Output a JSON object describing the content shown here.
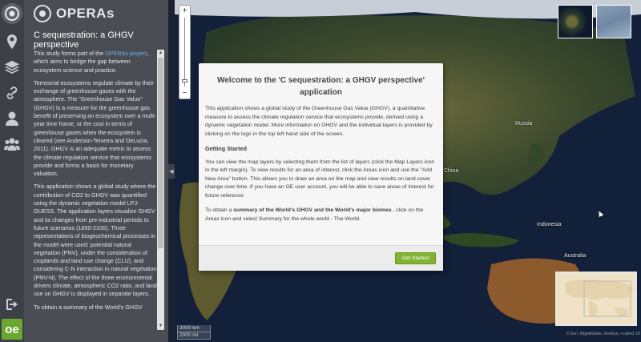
{
  "rail": {
    "items": [
      {
        "name": "logo",
        "icon": "globe-logo-icon"
      },
      {
        "name": "areas",
        "icon": "map-marker-icon"
      },
      {
        "name": "layers",
        "icon": "layers-icon"
      },
      {
        "name": "links",
        "icon": "link-icon"
      },
      {
        "name": "user",
        "icon": "user-icon"
      },
      {
        "name": "community",
        "icon": "users-group-icon"
      },
      {
        "name": "logout",
        "icon": "sign-out-icon"
      }
    ],
    "oe_label": "oe"
  },
  "panel": {
    "brand": "OPERAs",
    "title": "C sequestration: a GHGV perspective",
    "intro_pre": "This study forms part of the ",
    "intro_link": "OPERAs project",
    "intro_post": ", which aims to bridge the gap between ecosystem science and practice.",
    "para2": "Terrestrial ecosystems regulate climate by their exchange of greenhouse-gases with the atmosphere. The \"Greenhouse Gas Value\" (GHGV) is a measure for the greenhouse gas benefit of preserving an ecosystem over a multi-year time frame, or the cost in terms of greenhouse gases when the ecosystem is cleared (see Anderson-Teixeira and DeLucia, 2011). GHGV is an adequate metric to assess the climate regulation service that ecosystems provide and forms a basis for monetary valuation.",
    "para3": "This application shows a global study where the contribution of CO2 to GHGV was quantified using the dynamic vegetation model LPJ-GUESS. The application layers visualize GHGV and its changes from pre-industrial periods to future scenarios (1850-2100). Three representations of biogeochemical processes in the model were used: potential natural vegetation (PNV), under the consideration of croplands and land use change (CLU), and considering C-N interaction in natural vegetation (PNV-N). The effect of the three environmental drivers climate, atmospheric CO2 ratio, and land use on GHGV is displayed in separate layers.",
    "para4": "To obtain a summary of the World's GHGV"
  },
  "map": {
    "labels": [
      "Russia",
      "China",
      "Indonesia",
      "Australia"
    ],
    "scale_a": "3000 km",
    "scale_b": "2000 mi",
    "attribution": "© Esri, DigitalGlobe, GeoEye, i-cubed, USDA FSA, USGS, AEX, Getmapping, Aerogrid, IGN, IGP, swisstopo, and the GIS User Community",
    "zoom_in": "+",
    "zoom_out": "−"
  },
  "modal": {
    "title": "Welcome to the 'C sequestration: a GHGV perspective' application",
    "p1": "This application shows a global study of the Greenhouse Gas Value (GHGV), a quantitative measure to assess the climate regulation service that ecosystems provide, derived using a dynamic vegetation model. More information on GHGV and the individual layers is provided by clicking on the logo in the top left hand side of the screen.",
    "heading": "Getting Started",
    "p2": "You can view the map layers by selecting them from the list of layers (click the Map Layers icon in the left margin). To view results for an area of interest, click the Areas icon and use the \"Add New Area\" button. This allows you to draw an area on the map and view results on land cover change over time. If you have an OE user account, you will be able to save areas of interest for future reference",
    "p3_pre": "To obtain a ",
    "p3_bold": "summary of the World's GHGV and the World's major biomes",
    "p3_post": " , click on the Areas icon and select Summary for the whole world - The World.",
    "button": "Get Started"
  }
}
